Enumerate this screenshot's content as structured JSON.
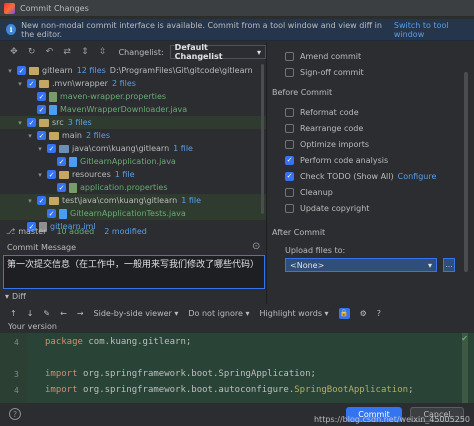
{
  "window": {
    "title": "Commit Changes"
  },
  "banner": {
    "text": "New non-modal commit interface is available. Commit from a tool window and view diff in the editor.",
    "link": "Switch to tool window"
  },
  "toolbar": {
    "changelist_label": "Changelist:",
    "changelist_value": "Default Changelist"
  },
  "tree": [
    {
      "name": "gitlearn",
      "count": "12 files",
      "path": "D:\\ProgramFiles\\Git\\gitcode\\gitlearn",
      "kind": "folder",
      "level": 0,
      "arrow": "▾"
    },
    {
      "name": ".mvn\\wrapper",
      "count": "2 files",
      "kind": "folder",
      "level": 1,
      "arrow": "▾"
    },
    {
      "name": "maven-wrapper.properties",
      "kind": "props",
      "level": 2,
      "color": "green"
    },
    {
      "name": "MavenWrapperDownloader.java",
      "kind": "java",
      "level": 2,
      "color": "green"
    },
    {
      "name": "src",
      "count": "3 files",
      "kind": "folder",
      "level": 1,
      "arrow": "▾",
      "selected": true
    },
    {
      "name": "main",
      "count": "2 files",
      "kind": "folder",
      "level": 2,
      "arrow": "▾"
    },
    {
      "name": "java\\com\\kuang\\gitlearn",
      "count": "1 file",
      "kind": "folder-blue",
      "level": 3,
      "arrow": "▾"
    },
    {
      "name": "GitlearnApplication.java",
      "kind": "java",
      "level": 4,
      "color": "green"
    },
    {
      "name": "resources",
      "count": "1 file",
      "kind": "folder",
      "level": 3,
      "arrow": "▾"
    },
    {
      "name": "application.properties",
      "kind": "props",
      "level": 4,
      "color": "green"
    },
    {
      "name": "test\\java\\com\\kuang\\gitlearn",
      "count": "1 file",
      "kind": "folder",
      "level": 2,
      "arrow": "▾",
      "selected": true
    },
    {
      "name": "GitlearnApplicationTests.java",
      "kind": "java",
      "level": 3,
      "color": "green",
      "selected": true
    },
    {
      "name": "gitlearn.iml",
      "kind": "iml",
      "level": 1,
      "color": "blue"
    }
  ],
  "status": {
    "branch": "master",
    "added": "10 added",
    "modified": "2 modified"
  },
  "commit_message": {
    "label": "Commit Message",
    "text": "第一次提交信息（在工作中，一般用来写我们修改了哪些代码）"
  },
  "diff": {
    "label": "Diff",
    "viewer": "Side-by-side viewer",
    "ignore": "Do not ignore",
    "highlight": "Highlight words",
    "your_version": "Your version",
    "lines": [
      {
        "num": "4",
        "parts": [
          [
            "kw",
            "package "
          ],
          [
            "",
            "com.kuang.gitlearn;"
          ]
        ]
      },
      {
        "num": "",
        "parts": []
      },
      {
        "num": "3",
        "parts": [
          [
            "kw",
            "import "
          ],
          [
            "",
            "org.springframework.boot.SpringApplication;"
          ]
        ]
      },
      {
        "num": "4",
        "parts": [
          [
            "kw",
            "import "
          ],
          [
            "",
            "org.springframework.boot.autoconfigure."
          ],
          [
            "ann",
            "SpringBootApplication"
          ],
          [
            "",
            ";"
          ]
        ]
      }
    ]
  },
  "options": {
    "amend": "Amend commit",
    "signoff": "Sign-off commit",
    "before_title": "Before Commit",
    "items": [
      {
        "label": "Reformat code",
        "checked": false
      },
      {
        "label": "Rearrange code",
        "checked": false
      },
      {
        "label": "Optimize imports",
        "checked": false
      },
      {
        "label": "Perform code analysis",
        "checked": true
      },
      {
        "label": "Check TODO (Show All)",
        "checked": true,
        "link": "Configure"
      },
      {
        "label": "Cleanup",
        "checked": false
      },
      {
        "label": "Update copyright",
        "checked": false
      }
    ],
    "after_title": "After Commit",
    "upload_label": "Upload files to:",
    "upload_value": "<None>"
  },
  "buttons": {
    "commit": "Commit",
    "cancel": "Cancel"
  },
  "watermark": "https://blog.csdn.net/weixin_45005250",
  "colors": {
    "accent": "#3574f0",
    "added": "#6aab73",
    "modified": "#5a9eea",
    "diff_bg": "#294436"
  }
}
